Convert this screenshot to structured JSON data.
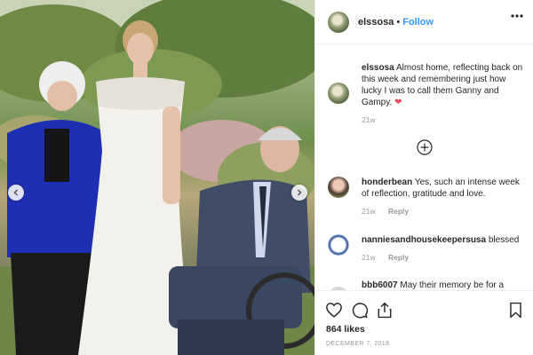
{
  "post": {
    "username": "elssosa",
    "follow_label": "Follow",
    "separator": "•",
    "caption_user": "elssosa",
    "caption_text": "Almost home, reflecting back on this week and remembering just how lucky I was to call them Ganny and Gampy.",
    "caption_emoji": "❤",
    "caption_time": "21w",
    "likes": "864 likes",
    "date": "DECEMBER 7, 2018"
  },
  "comments": [
    {
      "user": "honderbean",
      "text": "Yes, such an intense week of reflection, gratitude and love.",
      "time": "21w",
      "reply": "Reply"
    },
    {
      "user": "nanniesandhousekeepersusa",
      "text": "blessed",
      "time": "21w",
      "reply": "Reply"
    },
    {
      "user": "bbb6007",
      "text": "May their memory be for a"
    }
  ],
  "icons": {
    "more": "more-options-icon",
    "load_more": "plus-circle-icon",
    "like": "heart-icon",
    "comment": "comment-icon",
    "share": "share-icon",
    "save": "bookmark-icon",
    "prev": "chevron-left-icon",
    "next": "chevron-right-icon"
  },
  "colors": {
    "link": "#3897f0",
    "heart": "#ed4956",
    "meta": "#999999"
  }
}
